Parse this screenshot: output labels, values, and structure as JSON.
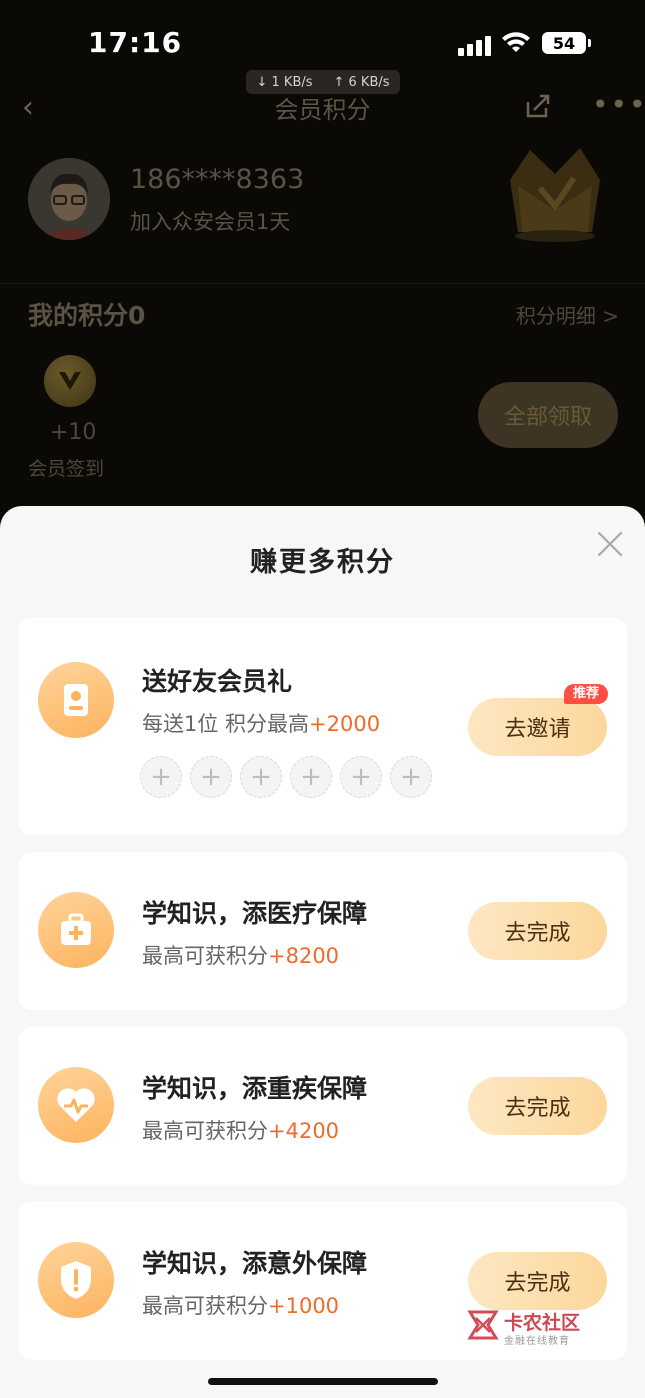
{
  "status_bar": {
    "time": "17:16",
    "down_speed": "↓ 1 KB/s",
    "up_speed": "↑ 6 KB/s",
    "battery": "54"
  },
  "nav": {
    "title": "会员积分",
    "back_icon": "chevron-left-icon",
    "share_icon": "share-icon",
    "more_icon": "more-icon"
  },
  "profile": {
    "phone": "186****8363",
    "joined": "加入众安会员1天"
  },
  "points": {
    "title": "我的积分0",
    "detail_link": "积分明细 >",
    "reward_amount": "+10",
    "reward_label": "会员签到",
    "claim_all": "全部领取"
  },
  "sheet": {
    "title": "赚更多积分",
    "tasks": [
      {
        "title": "送好友会员礼",
        "subtitle_prefix": "每送1位 积分最高",
        "subtitle_value": "+2000",
        "button": "去邀请",
        "badge": "推荐",
        "icon": "user-icon",
        "slots": [
          "+",
          "+",
          "+",
          "+",
          "+",
          "+"
        ]
      },
      {
        "title": "学知识，添医疗保障",
        "subtitle_prefix": "最高可获积分",
        "subtitle_value": "+8200",
        "button": "去完成",
        "icon": "medical-kit-icon"
      },
      {
        "title": "学知识，添重疾保障",
        "subtitle_prefix": "最高可获积分",
        "subtitle_value": "+4200",
        "button": "去完成",
        "icon": "heart-pulse-icon"
      },
      {
        "title": "学知识，添意外保障",
        "subtitle_prefix": "最高可获积分",
        "subtitle_value": "+1000",
        "button": "去完成",
        "icon": "shield-alert-icon"
      }
    ]
  },
  "watermark": {
    "title": "卡农社区",
    "subtitle": "金融在线教育"
  },
  "colors": {
    "accent": "#f06a2a",
    "button_gradient_start": "#fde7c2",
    "button_gradient_end": "#fcd79c",
    "icon_gradient_start": "#ffd49a",
    "icon_gradient_end": "#fdb35e",
    "badge": "#ff4f43"
  }
}
